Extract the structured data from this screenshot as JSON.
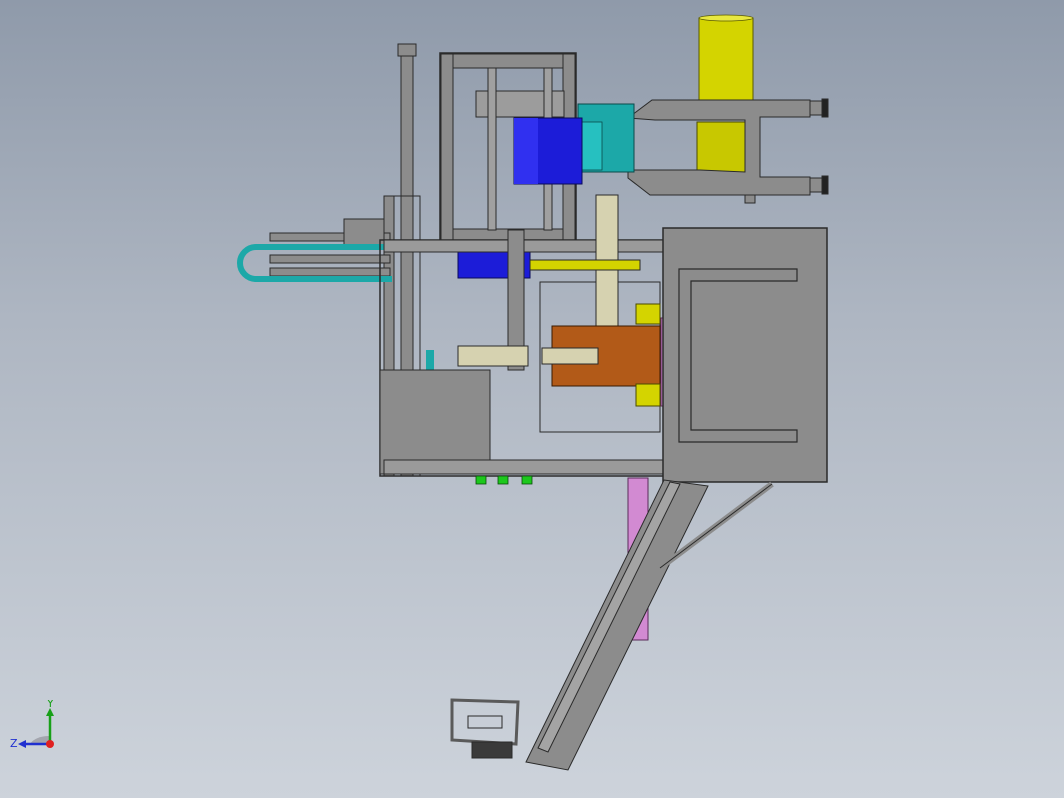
{
  "triad": {
    "y_label": "Y",
    "z_label": "Z",
    "x_color": "#e02020",
    "y_color": "#18a018",
    "z_color": "#2030d0"
  },
  "colors": {
    "frame": "#8c8c8c",
    "frame_dark": "#5a5a5a",
    "yellow": "#d4d400",
    "blue": "#1c1cd8",
    "teal": "#1ca8a8",
    "brown": "#b25a18",
    "pink": "#d28ad2",
    "green": "#1cc81c",
    "beige": "#d6d2b0"
  }
}
